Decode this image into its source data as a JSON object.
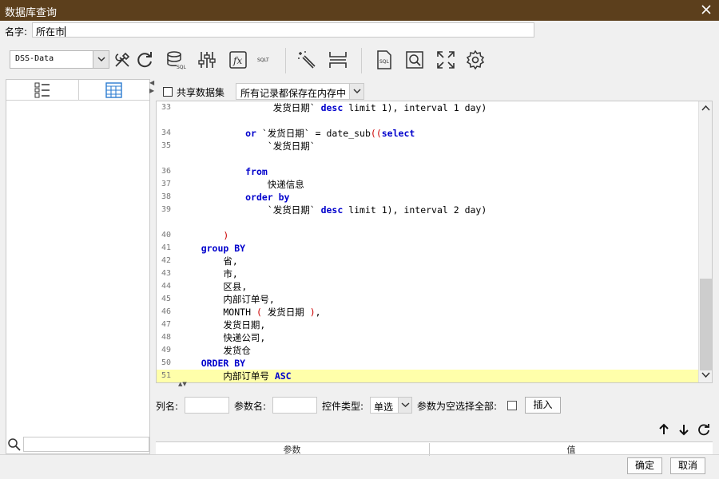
{
  "window": {
    "title": "数据库查询"
  },
  "name_row": {
    "label": "名字:",
    "value": "所在市"
  },
  "datasource": {
    "selected": "DSS-Data"
  },
  "toolbar_icons": [
    "wrench-screwdriver-icon",
    "refresh-icon",
    "database-sql-icon",
    "sliders-icon",
    "function-icon",
    "sql-text-icon",
    "magic-wand-icon",
    "split-rows-icon",
    "sql-file-icon",
    "search-document-icon",
    "fullscreen-icon",
    "gear-icon"
  ],
  "editor_toolbar": {
    "share_label": "共享数据集",
    "share_checked": false,
    "mode_selected": "所有记录都保存在内存中"
  },
  "code_lines": [
    {
      "n": "33",
      "segs": [
        [
          "",
          "                 发货日期` "
        ],
        [
          "kw",
          "desc"
        ],
        [
          "",
          " limit 1), interval 1 day)"
        ]
      ]
    },
    {
      "n": "34",
      "segs": [
        [
          "",
          "            "
        ],
        [
          "kw",
          "or"
        ],
        [
          "",
          " `发货日期` = date_sub"
        ],
        [
          "red",
          "(("
        ],
        [
          "kw",
          "select"
        ]
      ]
    },
    {
      "n": "35",
      "segs": [
        [
          "",
          "                `发货日期`"
        ]
      ]
    },
    {
      "n": "36",
      "segs": [
        [
          "",
          "            "
        ],
        [
          "kw",
          "from"
        ]
      ]
    },
    {
      "n": "37",
      "segs": [
        [
          "",
          "                快递信息"
        ]
      ]
    },
    {
      "n": "38",
      "segs": [
        [
          "",
          "            "
        ],
        [
          "kw",
          "order by"
        ]
      ]
    },
    {
      "n": "39",
      "segs": [
        [
          "",
          "                `发货日期` "
        ],
        [
          "kw",
          "desc"
        ],
        [
          "",
          " limit 1), interval 2 day)"
        ]
      ]
    },
    {
      "n": "40",
      "segs": [
        [
          "",
          "        "
        ],
        [
          "red",
          ")"
        ]
      ]
    },
    {
      "n": "41",
      "segs": [
        [
          "",
          "    "
        ],
        [
          "kw",
          "group BY"
        ]
      ]
    },
    {
      "n": "42",
      "segs": [
        [
          "",
          "        省,"
        ]
      ]
    },
    {
      "n": "43",
      "segs": [
        [
          "",
          "        市,"
        ]
      ]
    },
    {
      "n": "44",
      "segs": [
        [
          "",
          "        区县,"
        ]
      ]
    },
    {
      "n": "45",
      "segs": [
        [
          "",
          "        内部订单号,"
        ]
      ]
    },
    {
      "n": "46",
      "segs": [
        [
          "",
          "        MONTH "
        ],
        [
          "red",
          "("
        ],
        [
          "",
          " 发货日期 "
        ],
        [
          "red",
          ")"
        ],
        [
          "",
          ","
        ]
      ]
    },
    {
      "n": "47",
      "segs": [
        [
          "",
          "        发货日期,"
        ]
      ]
    },
    {
      "n": "48",
      "segs": [
        [
          "",
          "        快递公司,"
        ]
      ]
    },
    {
      "n": "49",
      "segs": [
        [
          "",
          "        发货仓"
        ]
      ]
    },
    {
      "n": "50",
      "segs": [
        [
          "",
          "    "
        ],
        [
          "kw",
          "ORDER BY"
        ]
      ]
    },
    {
      "n": "51",
      "segs": [
        [
          "",
          "        内部订单号 "
        ],
        [
          "kw",
          "ASC"
        ]
      ]
    }
  ],
  "params": {
    "col_label": "列名:",
    "param_label": "参数名:",
    "ctl_type_label": "控件类型:",
    "ctl_type_selected": "单选",
    "empty_all_label": "参数为空选择全部:",
    "insert_button": "插入"
  },
  "param_table": {
    "col_param": "参数",
    "col_value": "值"
  },
  "footer": {
    "ok": "确定",
    "cancel": "取消"
  }
}
